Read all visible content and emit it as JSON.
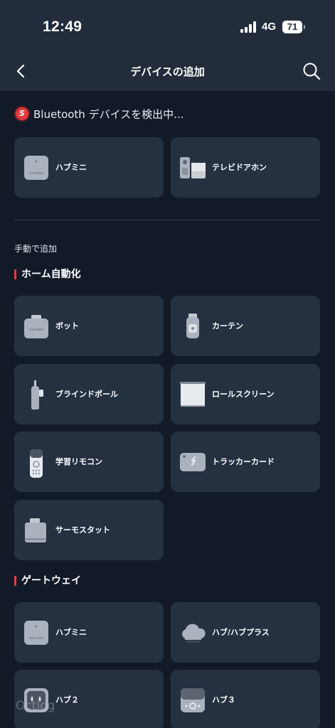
{
  "status": {
    "time": "12:49",
    "network": "4G",
    "battery": "71"
  },
  "nav": {
    "title": "デバイスの追加"
  },
  "scan": {
    "badge": "S",
    "text": "Bluetooth デバイスを検出中..."
  },
  "found_devices": [
    {
      "label": "ハブミニ",
      "icon": "hub-mini-icon"
    },
    {
      "label": "テレビドアホン",
      "icon": "video-doorbell-icon"
    }
  ],
  "manual_label": "手動で追加",
  "sections": {
    "home_automation": {
      "title": "ホーム自動化",
      "items": [
        {
          "label": "ボット",
          "icon": "bot-icon"
        },
        {
          "label": "カーテン",
          "icon": "curtain-icon"
        },
        {
          "label": "ブラインドポール",
          "icon": "blind-tilt-icon"
        },
        {
          "label": "ロールスクリーン",
          "icon": "roller-shade-icon"
        },
        {
          "label": "学習リモコン",
          "icon": "remote-icon"
        },
        {
          "label": "トラッカーカード",
          "icon": "tracker-card-icon"
        },
        {
          "label": "サーモスタット",
          "icon": "thermostat-icon"
        }
      ]
    },
    "gateway": {
      "title": "ゲートウェイ",
      "items": [
        {
          "label": "ハブミニ",
          "icon": "hub-mini-icon"
        },
        {
          "label": "ハブ/ハブプラス",
          "icon": "hub-plus-icon"
        },
        {
          "label": "ハブ２",
          "icon": "hub-2-icon"
        },
        {
          "label": "ハブ３",
          "icon": "hub-3-icon"
        }
      ]
    }
  },
  "brand_text": "SwitchBot",
  "watermark": "Octlog"
}
